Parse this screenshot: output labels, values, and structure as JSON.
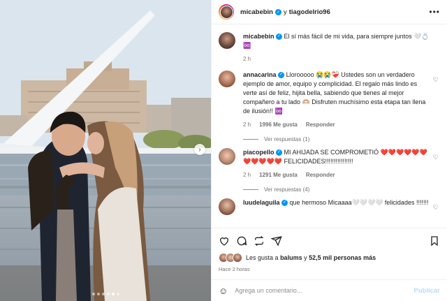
{
  "header": {
    "user1": "micabebin",
    "joiner": "y",
    "user2": "tiagodelrio96",
    "more_icon": "more-horizontal-icon"
  },
  "caption": {
    "username": "micabebin",
    "text": "El sí más fácil de mi vida, para siempre juntos 🤍💍",
    "text2": "♾️",
    "time": "2 h"
  },
  "comments": [
    {
      "username": "annacarina",
      "text": "Llorooooo 😭😭❤️‍🩹 Ustedes son un verdadero ejemplo de amor, equipo y complicidad. El regalo más lindo es verte así de feliz, hijita bella, sabiendo que tienes al mejor compañero a tu lado 🫶🏼 Disfruten muchísimo esta etapa tan llena de ilusión!! ♾️",
      "time": "2 h",
      "likes": "1996 Me gusta",
      "reply": "Responder",
      "replies": "Ver respuestas (1)"
    },
    {
      "username": "piacopello",
      "text": "MI AHIJADA SE COMPROMETIÓ ❤️❤️❤️❤️❤️❤️❤️❤️❤️❤️❤️ FELICIDADES!!!!!!!!!!!!!!!!",
      "time": "2 h",
      "likes": "1291 Me gusta",
      "reply": "Responder",
      "replies": "Ver respuestas (4)"
    },
    {
      "username": "luudelaguila",
      "text": "que hermoso Micaaaa🤍🤍🤍🤍 felicidades !!!!!!!"
    }
  ],
  "actions": {
    "likes_prefix": "Les gusta a",
    "liker": "balums",
    "likes_joiner": "y",
    "likes_count": "52,5 mil personas más",
    "time": "Hace 2 horas"
  },
  "comment_box": {
    "placeholder": "Agrega un comentario...",
    "post": "Publicar"
  },
  "carousel": {
    "total": 6,
    "active": 5
  },
  "colors": {
    "accent": "#0095f6",
    "post_disabled": "#b2dffc",
    "muted": "#737373"
  }
}
